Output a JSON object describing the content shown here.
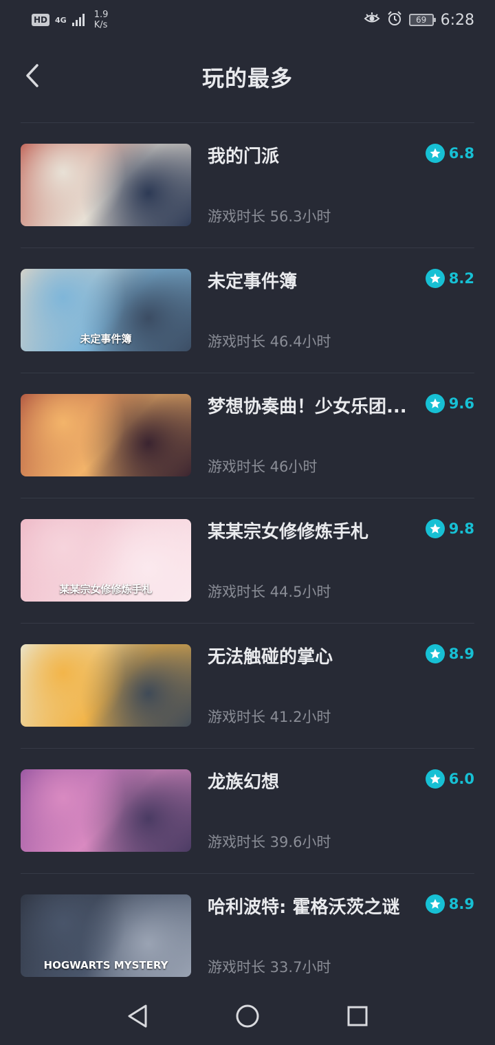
{
  "status_bar": {
    "hd": "HD",
    "network": "4G",
    "speed_value": "1.9",
    "speed_unit": "K/s",
    "battery": "69",
    "time": "6:28"
  },
  "header": {
    "title": "玩的最多"
  },
  "games": [
    {
      "title": "我的门派",
      "rating": "6.8",
      "playtime": "游戏时长 56.3小时",
      "thumb_colors": [
        "#e8e1d6",
        "#b94a3e",
        "#2d3a55"
      ],
      "caption": ""
    },
    {
      "title": "未定事件簿",
      "rating": "8.2",
      "playtime": "游戏时长 46.4小时",
      "thumb_colors": [
        "#7fb6d9",
        "#e9d8c4",
        "#3b4c63"
      ],
      "caption": "未定事件簿"
    },
    {
      "title": "梦想协奏曲！少女乐团...",
      "rating": "9.6",
      "playtime": "游戏时长 46小时",
      "thumb_colors": [
        "#f3b46a",
        "#a2443a",
        "#3a2430"
      ],
      "caption": ""
    },
    {
      "title": "某某宗女修修炼手札",
      "rating": "9.8",
      "playtime": "游戏时长 44.5小时",
      "thumb_colors": [
        "#f6d4dc",
        "#ecb3c2",
        "#fbe9ee"
      ],
      "caption": "某某宗女修修炼手札"
    },
    {
      "title": "无法触碰的掌心",
      "rating": "8.9",
      "playtime": "游戏时长 41.2小时",
      "thumb_colors": [
        "#f2b54a",
        "#e7efe9",
        "#3f4a57"
      ],
      "caption": ""
    },
    {
      "title": "龙族幻想",
      "rating": "6.0",
      "playtime": "游戏时长 39.6小时",
      "thumb_colors": [
        "#d98ac1",
        "#8a4c9a",
        "#4a3b63"
      ],
      "caption": ""
    },
    {
      "title": "哈利波特: 霍格沃茨之谜",
      "rating": "8.9",
      "playtime": "游戏时长 33.7小时",
      "thumb_colors": [
        "#49556a",
        "#2a2f3b",
        "#9aa3b3"
      ],
      "caption": "HOGWARTS MYSTERY"
    }
  ],
  "colors": {
    "accent": "#17c0d4",
    "background": "#272a35",
    "divider": "#363a46",
    "muted_text": "#8a8d96"
  },
  "icons": {
    "back": "chevron-left-icon",
    "rating": "star-icon",
    "nav_back": "triangle-back-icon",
    "nav_home": "circle-home-icon",
    "nav_recent": "square-recent-icon"
  }
}
